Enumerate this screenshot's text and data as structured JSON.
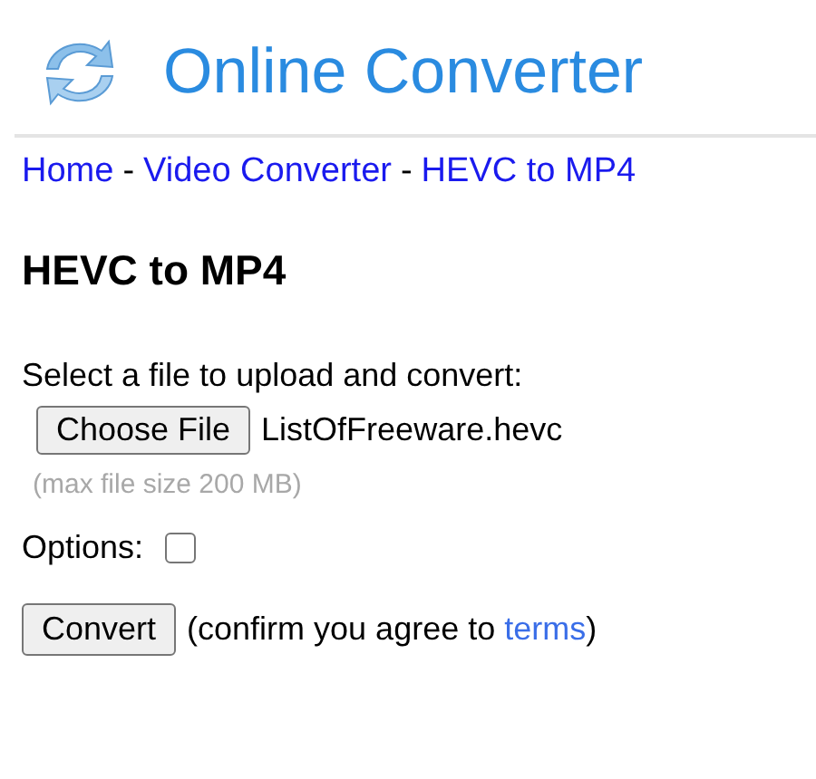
{
  "header": {
    "title": "Online Converter"
  },
  "breadcrumb": {
    "items": [
      "Home",
      "Video Converter",
      "HEVC to MP4"
    ],
    "separators": [
      "-",
      "-"
    ]
  },
  "heading": "HEVC to MP4",
  "upload": {
    "prompt": "Select a file to upload and convert:",
    "button": "Choose File",
    "file_name": "ListOfFreeware.hevc",
    "hint": "(max file size 200 MB)"
  },
  "options": {
    "label": "Options:",
    "checked": false
  },
  "convert": {
    "button": "Convert",
    "note_before": "(confirm you agree to ",
    "link": "terms",
    "note_after": ")"
  }
}
